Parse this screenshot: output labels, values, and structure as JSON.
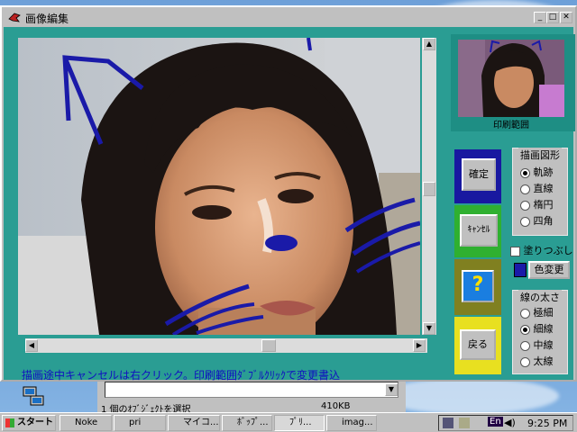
{
  "window": {
    "title": "画像編集",
    "status_message": "描画途中キャンセルは右クリック。印刷範囲ﾀﾞﾌﾞﾙｸﾘｯｸで変更書込"
  },
  "preview": {
    "label": "印刷範囲"
  },
  "buttons": {
    "confirm": "確定",
    "cancel": "ｷｬﾝｾﾙ",
    "help": "?",
    "back": "戻る",
    "color_change": "色変更"
  },
  "shape_group": {
    "title": "描画図形",
    "options": [
      "軌跡",
      "直線",
      "楕円",
      "四角"
    ],
    "selected": 0
  },
  "fill_option": {
    "label": "塗りつぶし",
    "checked": false
  },
  "line_width_group": {
    "title": "線の太さ",
    "options": [
      "極細",
      "細線",
      "中線",
      "太線"
    ],
    "selected": 1
  },
  "colors": {
    "accent": "#2a9d93",
    "draw_color": "#1a1aa8",
    "help_bg": "#1a7ee0"
  },
  "explorer": {
    "status_left": "1 個のｵﾌﾞｼﾞｪｸﾄを選択",
    "status_right": "410KB"
  },
  "taskbar": {
    "start_label": "スタート",
    "tasks": [
      "Noke",
      "pri",
      "マイコ...",
      "ﾎﾞｯﾌﾟ...",
      "ﾌﾟﾘ...",
      "imag..."
    ],
    "clock": "9:25 PM",
    "ime": "En"
  }
}
